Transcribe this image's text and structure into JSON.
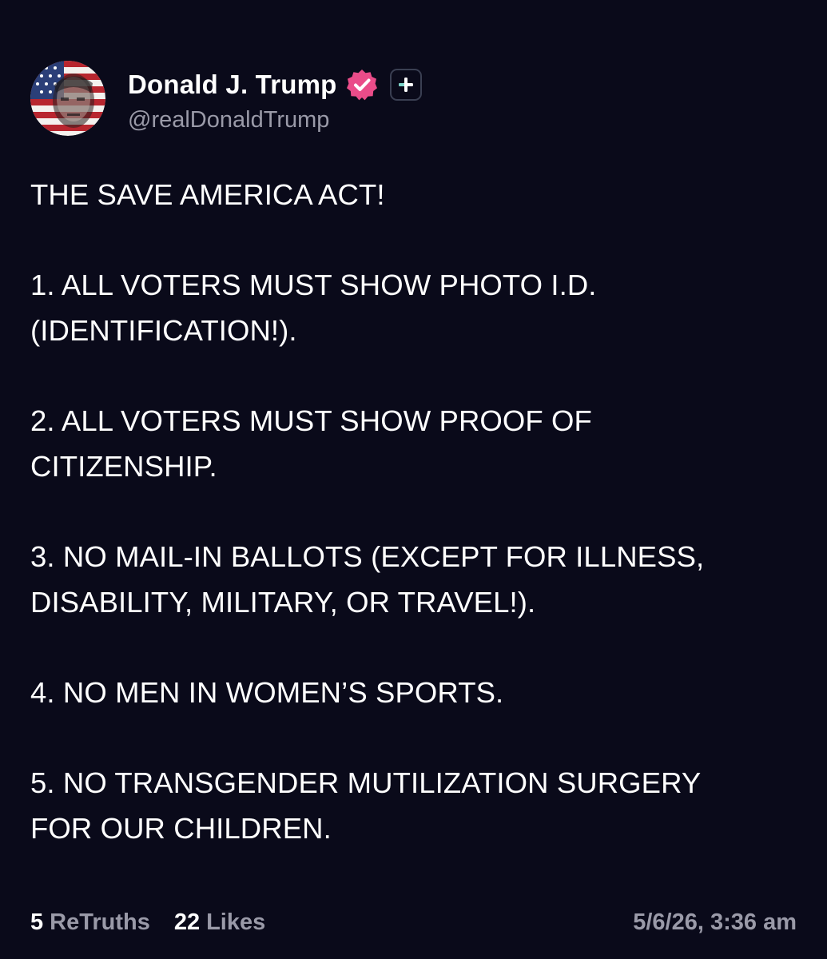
{
  "author": {
    "display_name": "Donald J. Trump",
    "handle": "@realDonaldTrump",
    "verified_icon": "verified-badge-icon",
    "plus_icon": "plus-icon",
    "colors": {
      "verified": "#ea4c89",
      "badge_border": "#3a3f52",
      "background": "#0a0a1a",
      "muted_text": "#9a9aa8"
    }
  },
  "post": {
    "paragraphs": [
      {
        "lines": [
          "THE SAVE AMERICA ACT!"
        ]
      },
      {
        "lines": [
          "1. ALL VOTERS MUST SHOW PHOTO I.D.",
          "(IDENTIFICATION!)."
        ]
      },
      {
        "lines": [
          "2. ALL VOTERS MUST SHOW PROOF OF",
          "CITIZENSHIP."
        ]
      },
      {
        "lines": [
          "3. NO MAIL-IN BALLOTS (EXCEPT FOR ILLNESS,",
          "DISABILITY, MILITARY, OR TRAVEL!)."
        ]
      },
      {
        "lines": [
          "4. NO MEN IN WOMEN’S SPORTS."
        ]
      },
      {
        "lines": [
          "5. NO TRANSGENDER MUTILIZATION SURGERY",
          "FOR OUR CHILDREN."
        ]
      }
    ]
  },
  "footer": {
    "retruths_count": "5",
    "retruths_label": "ReTruths",
    "likes_count": "22",
    "likes_label": "Likes",
    "timestamp": "5/6/26, 3:36 am"
  }
}
